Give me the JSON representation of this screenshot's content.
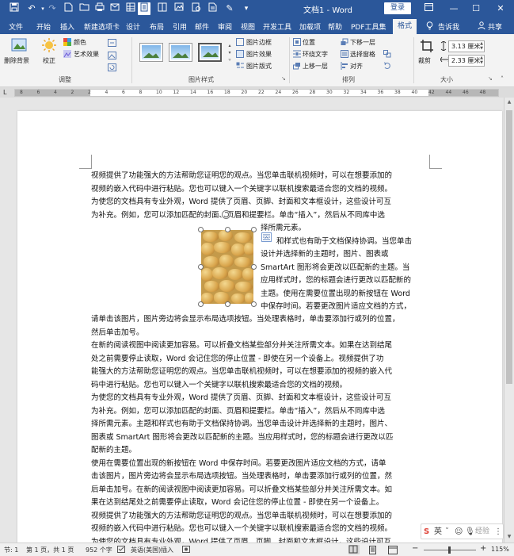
{
  "titlebar": {
    "doc_title": "文档1 - Word",
    "login": "登录",
    "qa_icons": [
      "save-icon",
      "undo-icon",
      "redo-icon",
      "new-icon",
      "open-icon",
      "print-layout-icon",
      "read-mode-icon",
      "print-preview-icon",
      "email-icon",
      "customize-icon"
    ]
  },
  "tabs": [
    "文件",
    "开始",
    "插入",
    "新建选项卡",
    "设计",
    "布局",
    "引用",
    "邮件",
    "审阅",
    "视图",
    "开发工具",
    "加载项",
    "帮助",
    "PDF工具集",
    "格式"
  ],
  "tell_me": "告诉我",
  "share": "共享",
  "ribbon": {
    "remove_bg": "删除背景",
    "correct": "校正",
    "color": "颜色",
    "art_effect": "艺术效果",
    "adjust_label": "调整",
    "styles_label": "图片样式",
    "pic_border": "图片边框",
    "pic_effect": "图片效果",
    "pic_layout": "图片版式",
    "position": "位置",
    "wrap_text": "环绕文字",
    "bring_forward": "上移一层",
    "send_backward": "下移一层",
    "selection_pane": "选择窗格",
    "align": "对齐",
    "arrange_label": "排列",
    "crop": "裁剪",
    "height": "3.13 厘米",
    "width": "2.33 厘米",
    "size_label": "大小"
  },
  "ruler_numbers": [
    "8",
    "6",
    "4",
    "2",
    "2",
    "4",
    "6",
    "8",
    "10",
    "12",
    "14",
    "16",
    "18",
    "20",
    "22",
    "24",
    "26",
    "28",
    "30",
    "32",
    "34",
    "36",
    "38",
    "40",
    "42",
    "44",
    "46",
    "48"
  ],
  "document": {
    "lines_top": [
      "视频提供了功能强大的方法帮助您证明您的观点。当您单击联机视频时，可以在想要添加的",
      "视频的嵌入代码中进行粘贴。您也可以键入一个关键字以联机搜索最适合您的文档的视频。",
      "为使您的文档具有专业外观，Word 提供了页眉、页脚、封面和文本框设计，这些设计可互",
      "为补充。例如，您可以添加匹配的封面、页眉和提要栏。单击“插入”，然后从不同库中选"
    ],
    "lines_wrap": [
      "择所需元素。",
      "和样式也有助于文档保持协调。当您单击",
      "设计并选择新的主题时，图片、图表或",
      "SmartArt 图形将会更改以匹配新的主题。当",
      "应用样式时，您的标题会进行更改以匹配新的",
      "主题。使用在需要位置出现的新按钮在 Word",
      "中保存时间。若要更改图片适应文档的方式，"
    ],
    "lines_bottom": [
      "请单击该图片，图片旁边将会显示布局选项按钮。当处理表格时，单击要添加行或列的位置，",
      "然后单击加号。",
      "在新的阅读视图中阅读更加容易。可以折叠文档某些部分并关注所需文本。如果在达到结尾",
      "处之前需要停止读取，Word 会记住您的停止位置 - 即使在另一个设备上。视频提供了功",
      "能强大的方法帮助您证明您的观点。当您单击联机视频时，可以在想要添加的视频的嵌入代",
      "码中进行粘贴。您也可以键入一个关键字以联机搜索最适合您的文档的视频。",
      "为使您的文档具有专业外观，Word 提供了页眉、页脚、封面和文本框设计，这些设计可互",
      "为补充。例如，您可以添加匹配的封面、页眉和提要栏。单击“插入”，然后从不同库中选",
      "择所需元素。主题和样式也有助于文档保持协调。当您单击设计并选择新的主题时，图片、",
      "图表或 SmartArt 图形将会更改以匹配新的主题。当应用样式时，您的标题会进行更改以匹",
      "配新的主题。",
      "使用在需要位置出现的新按钮在 Word 中保存时间。若要更改图片适应文档的方式，请单",
      "击该图片，图片旁边将会显示布局选项按钮。当处理表格时，单击要添加行或列的位置，然",
      "后单击加号。在新的阅读视图中阅读更加容易。可以折叠文档某些部分并关注所需文本。如",
      "果在达到结尾处之前需要停止读取，Word 会记住您的停止位置 - 即使在另一个设备上。",
      "视频提供了功能强大的方法帮助您证明您的观点。当您单击联机视频时，可以在想要添加的",
      "视频的嵌入代码中进行粘贴。您也可以键入一个关键字以联机搜索最适合您的文档的视频。",
      "为使您的文档具有专业外观，Word 提供了页眉、页脚、封面和文本框设计，这些设计可互"
    ]
  },
  "status": {
    "section": "节: 1",
    "page": "第 1 页，共 1 页",
    "words": "952 个字",
    "language": "英语(美国)",
    "insert": "插入",
    "zoom": "115%"
  },
  "ime": {
    "lang": "英",
    "watermark": "经验"
  },
  "colors": {
    "title_blue": "#2b579a",
    "ribbon_bg": "#f3f3f3"
  }
}
